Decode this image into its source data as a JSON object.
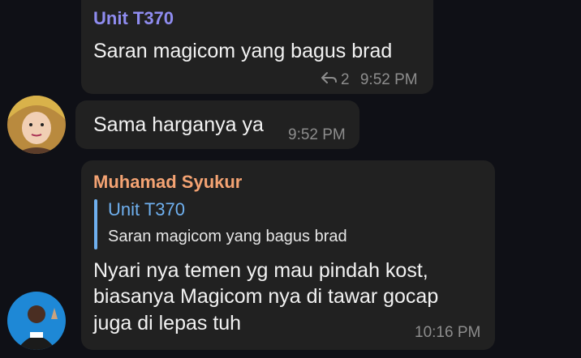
{
  "messages": [
    {
      "sender": "Unit T370",
      "text": "Saran magicom yang bagus brad",
      "reply_count": "2",
      "time": "9:52 PM",
      "sender_color": "#8f8cf0"
    },
    {
      "text": "Sama harganya ya",
      "time": "9:52 PM"
    },
    {
      "sender": "Muhamad Syukur",
      "sender_color": "#f4a373",
      "quote": {
        "sender": "Unit T370",
        "text": "Saran magicom yang bagus brad",
        "color": "#6fb0ef"
      },
      "lines": [
        "Nyari nya temen yg mau pindah kost,",
        "biasanya Magicom nya di tawar gocap",
        "juga di lepas tuh"
      ],
      "time": "10:16 PM"
    }
  ]
}
